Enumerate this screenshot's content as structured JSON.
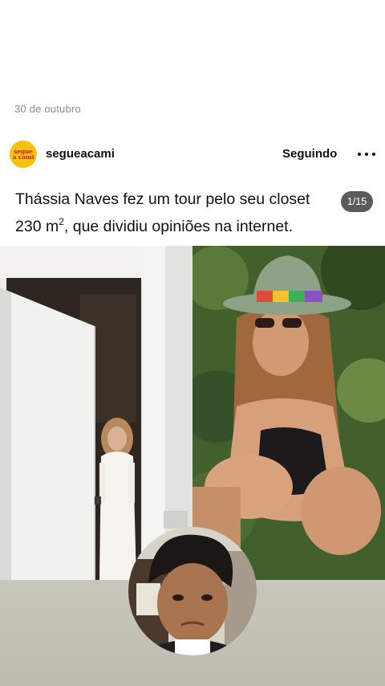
{
  "post": {
    "date": "30 de outubro",
    "author": {
      "username": "segueacami",
      "avatar_text_line1": "segue",
      "avatar_text_line2": "a cami"
    },
    "follow_label": "Seguindo",
    "more_icon": "more-horizontal-icon",
    "caption_main": "Thássia Naves fez um tour pelo seu closet 230 m",
    "caption_sup": "2",
    "caption_end": ", que dividiu opiniões na internet.",
    "slide_counter": "1/15"
  },
  "colors": {
    "avatar_bg": "#f4c20d",
    "avatar_text": "#c0241b",
    "counter_bg": "#5b5b5b"
  }
}
